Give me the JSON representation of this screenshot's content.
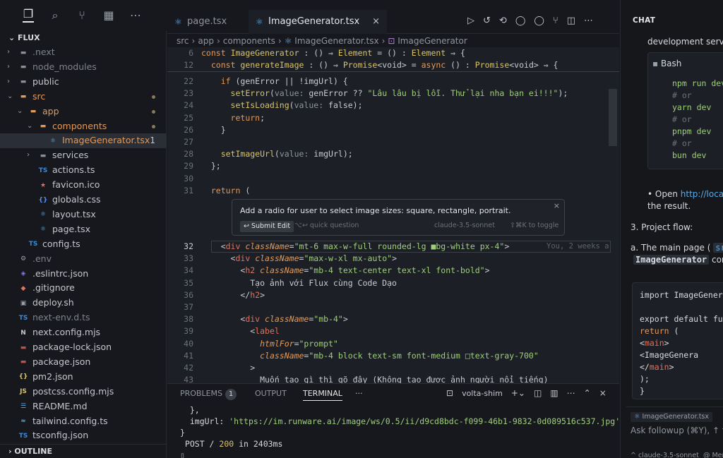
{
  "explorer": {
    "root": "FLUX",
    "outline": "OUTLINE",
    "items": [
      {
        "label": ".next",
        "depth": 0,
        "type": "folder",
        "dim": true
      },
      {
        "label": "node_modules",
        "depth": 0,
        "type": "folder",
        "dim": true
      },
      {
        "label": "public",
        "depth": 0,
        "type": "folder"
      },
      {
        "label": "src",
        "depth": 0,
        "type": "folder-open",
        "dot": true,
        "color": "#e39a5a"
      },
      {
        "label": "app",
        "depth": 1,
        "type": "folder-open",
        "dot": true,
        "color": "#e39a5a"
      },
      {
        "label": "components",
        "depth": 2,
        "type": "folder-open",
        "dot": true,
        "color": "#e39a5a"
      },
      {
        "label": "ImageGenerator.tsx",
        "depth": 3,
        "type": "react",
        "selected": true,
        "count": "1",
        "color": "#e39a5a"
      },
      {
        "label": "services",
        "depth": 2,
        "type": "folder"
      },
      {
        "label": "actions.ts",
        "depth": 2,
        "type": "ts"
      },
      {
        "label": "favicon.ico",
        "depth": 2,
        "type": "star"
      },
      {
        "label": "globals.css",
        "depth": 2,
        "type": "css"
      },
      {
        "label": "layout.tsx",
        "depth": 2,
        "type": "react"
      },
      {
        "label": "page.tsx",
        "depth": 2,
        "type": "react"
      },
      {
        "label": "config.ts",
        "depth": 1,
        "type": "ts"
      },
      {
        "label": ".env",
        "depth": 0,
        "type": "gear",
        "dim": true
      },
      {
        "label": ".eslintrc.json",
        "depth": 0,
        "type": "eslint"
      },
      {
        "label": ".gitignore",
        "depth": 0,
        "type": "git"
      },
      {
        "label": "deploy.sh",
        "depth": 0,
        "type": "sh"
      },
      {
        "label": "next-env.d.ts",
        "depth": 0,
        "type": "ts",
        "dim": true
      },
      {
        "label": "next.config.mjs",
        "depth": 0,
        "type": "next"
      },
      {
        "label": "package-lock.json",
        "depth": 0,
        "type": "npm"
      },
      {
        "label": "package.json",
        "depth": 0,
        "type": "npm"
      },
      {
        "label": "pm2.json",
        "depth": 0,
        "type": "json"
      },
      {
        "label": "postcss.config.mjs",
        "depth": 0,
        "type": "js"
      },
      {
        "label": "README.md",
        "depth": 0,
        "type": "md"
      },
      {
        "label": "tailwind.config.ts",
        "depth": 0,
        "type": "tw"
      },
      {
        "label": "tsconfig.json",
        "depth": 0,
        "type": "tsjson"
      }
    ]
  },
  "tabs": [
    {
      "label": "page.tsx",
      "active": false
    },
    {
      "label": "ImageGenerator.tsx",
      "active": true
    }
  ],
  "breadcrumb": [
    "src",
    "app",
    "components",
    "ImageGenerator.tsx",
    "ImageGenerator"
  ],
  "sticky": [
    {
      "n": "6",
      "code": "const ImageGenerator : () ⇒ Element = () : Element ⇒ {"
    },
    {
      "n": "12",
      "code": "  const generateImage : () ⇒ Promise<void> = async () : Promise<void> ⇒ {"
    }
  ],
  "code_top": [
    {
      "n": "22",
      "code": "    if (genError || !imgUrl) {"
    },
    {
      "n": "23",
      "code": "      setError(value: genError ?? \"Lâu lâu bị lỗi. Thử lại nha bạn ei!!!\");"
    },
    {
      "n": "24",
      "code": "      setIsLoading(value: false);"
    },
    {
      "n": "25",
      "code": "      return;"
    },
    {
      "n": "26",
      "code": "    }"
    },
    {
      "n": "27",
      "code": ""
    },
    {
      "n": "28",
      "code": "    setImageUrl(value: imgUrl);"
    },
    {
      "n": "29",
      "code": "  };"
    },
    {
      "n": "30",
      "code": ""
    },
    {
      "n": "31",
      "code": "  return ("
    }
  ],
  "prompt": {
    "text": "Add a radio for user to select image sizes: square, rectangle, portrait.",
    "submit": "↩ Submit Edit",
    "quick": "⌥↩ quick question",
    "model": "claude-3.5-sonnet",
    "toggle": "⇧⌘K to toggle",
    "close": "×"
  },
  "code_bottom": [
    {
      "n": "32",
      "code": "    <div className=\"mt-6 max-w-full rounded-lg ■bg-white px-4\">"
    },
    {
      "n": "33",
      "code": "      <div className=\"max-w-xl mx-auto\">"
    },
    {
      "n": "34",
      "code": "        <h2 className=\"mb-4 text-center text-xl font-bold\">"
    },
    {
      "n": "35",
      "code": "          Tạo ảnh với Flux cùng Code Dạo"
    },
    {
      "n": "36",
      "code": "        </h2>"
    },
    {
      "n": "37",
      "code": ""
    },
    {
      "n": "38",
      "code": "        <div className=\"mb-4\">"
    },
    {
      "n": "39",
      "code": "          <label"
    },
    {
      "n": "40",
      "code": "            htmlFor=\"prompt\""
    },
    {
      "n": "41",
      "code": "            className=\"mb-4 block text-sm font-medium □text-gray-700\""
    },
    {
      "n": "42",
      "code": "          >"
    },
    {
      "n": "43",
      "code": "            Muốn tạo gì thì gõ đây (Không tạo được ảnh người nổi tiếng)"
    }
  ],
  "blame": "You, 2 weeks a",
  "panel": {
    "tabs": [
      "PROBLEMS",
      "OUTPUT",
      "TERMINAL",
      "···"
    ],
    "problems_count": "1",
    "shell": "volta-shim",
    "terminal": [
      "  },",
      "  imgUrl: 'https://im.runware.ai/image/ws/0.5/ii/d9cd8bdc-f099-46b1-9832-0d089516c537.jpg'",
      "}",
      " POST / 200 in 2403ms"
    ]
  },
  "chat": {
    "header": "CHAT",
    "l1": "development serve",
    "bash_label": "Bash",
    "bash": [
      "npm run dev",
      "# or",
      "yarn dev",
      "# or",
      "pnpm dev",
      "# or",
      "bun dev"
    ],
    "open_pre": "Open ",
    "open_link": "http://loca",
    "result": "the result.",
    "flow": "3. Project flow:",
    "main_pre": "a. The main page (",
    "main_code": "src",
    "main_comp": "ImageGenerator",
    "main_post": "cor",
    "code2": [
      "import ImageGenera",
      "",
      "export default fun",
      "  return (",
      "    <main>",
      "      <ImageGenera",
      "    </main>",
      "  );",
      "}"
    ],
    "chip": "ImageGenerator.tsx",
    "ask": "Ask followup (⌘Y), ↑ to",
    "model": "^ claude-3.5-sonnet",
    "mention": "@ Men"
  },
  "colors": {
    "accent": "#e39a5a",
    "string": "#9fcf7b",
    "func": "#d8c36a",
    "tag": "#e0735e"
  }
}
